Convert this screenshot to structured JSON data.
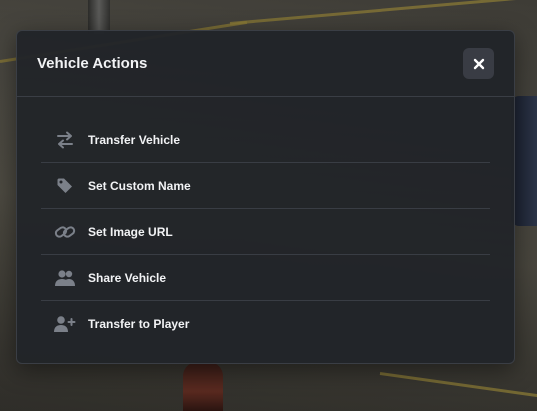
{
  "modal": {
    "title": "Vehicle Actions",
    "close_icon": "close-icon",
    "actions": [
      {
        "label": "Transfer Vehicle",
        "icon": "transfer-arrows-icon"
      },
      {
        "label": "Set Custom Name",
        "icon": "tag-icon"
      },
      {
        "label": "Set Image URL",
        "icon": "link-icon"
      },
      {
        "label": "Share Vehicle",
        "icon": "users-icon"
      },
      {
        "label": "Transfer to Player",
        "icon": "user-plus-icon"
      }
    ]
  },
  "colors": {
    "modal_bg": "#212429",
    "border": "#3a3e45",
    "text": "#f2f3f5",
    "icon": "#7b8089",
    "close_bg": "#393c44"
  }
}
